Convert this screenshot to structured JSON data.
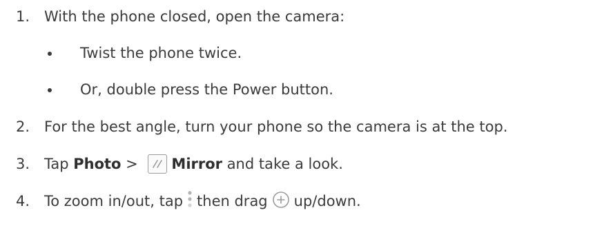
{
  "steps": [
    {
      "number": "1.",
      "text": "With the phone closed, open the camera:"
    },
    {
      "number": "2.",
      "text": "For the best angle, turn your phone so the camera is at the top."
    },
    {
      "number": "3.",
      "pre": "Tap ",
      "bold1": "Photo",
      "sep": " > ",
      "bold2": "Mirror",
      "post": " and take a look."
    },
    {
      "number": "4.",
      "pre": "To zoom in/out, tap",
      "mid": "then drag",
      "post": "up/down."
    }
  ],
  "bullets": [
    "Twist the phone twice.",
    "Or, double press the Power button."
  ],
  "icons": {
    "mirror": "mirror-mode-icon",
    "dots": "vertical-dots-icon",
    "zoom": "zoom-plus-icon"
  },
  "colors": {
    "text": "#3a3a3a",
    "icon_gray": "#9a9a9a"
  }
}
